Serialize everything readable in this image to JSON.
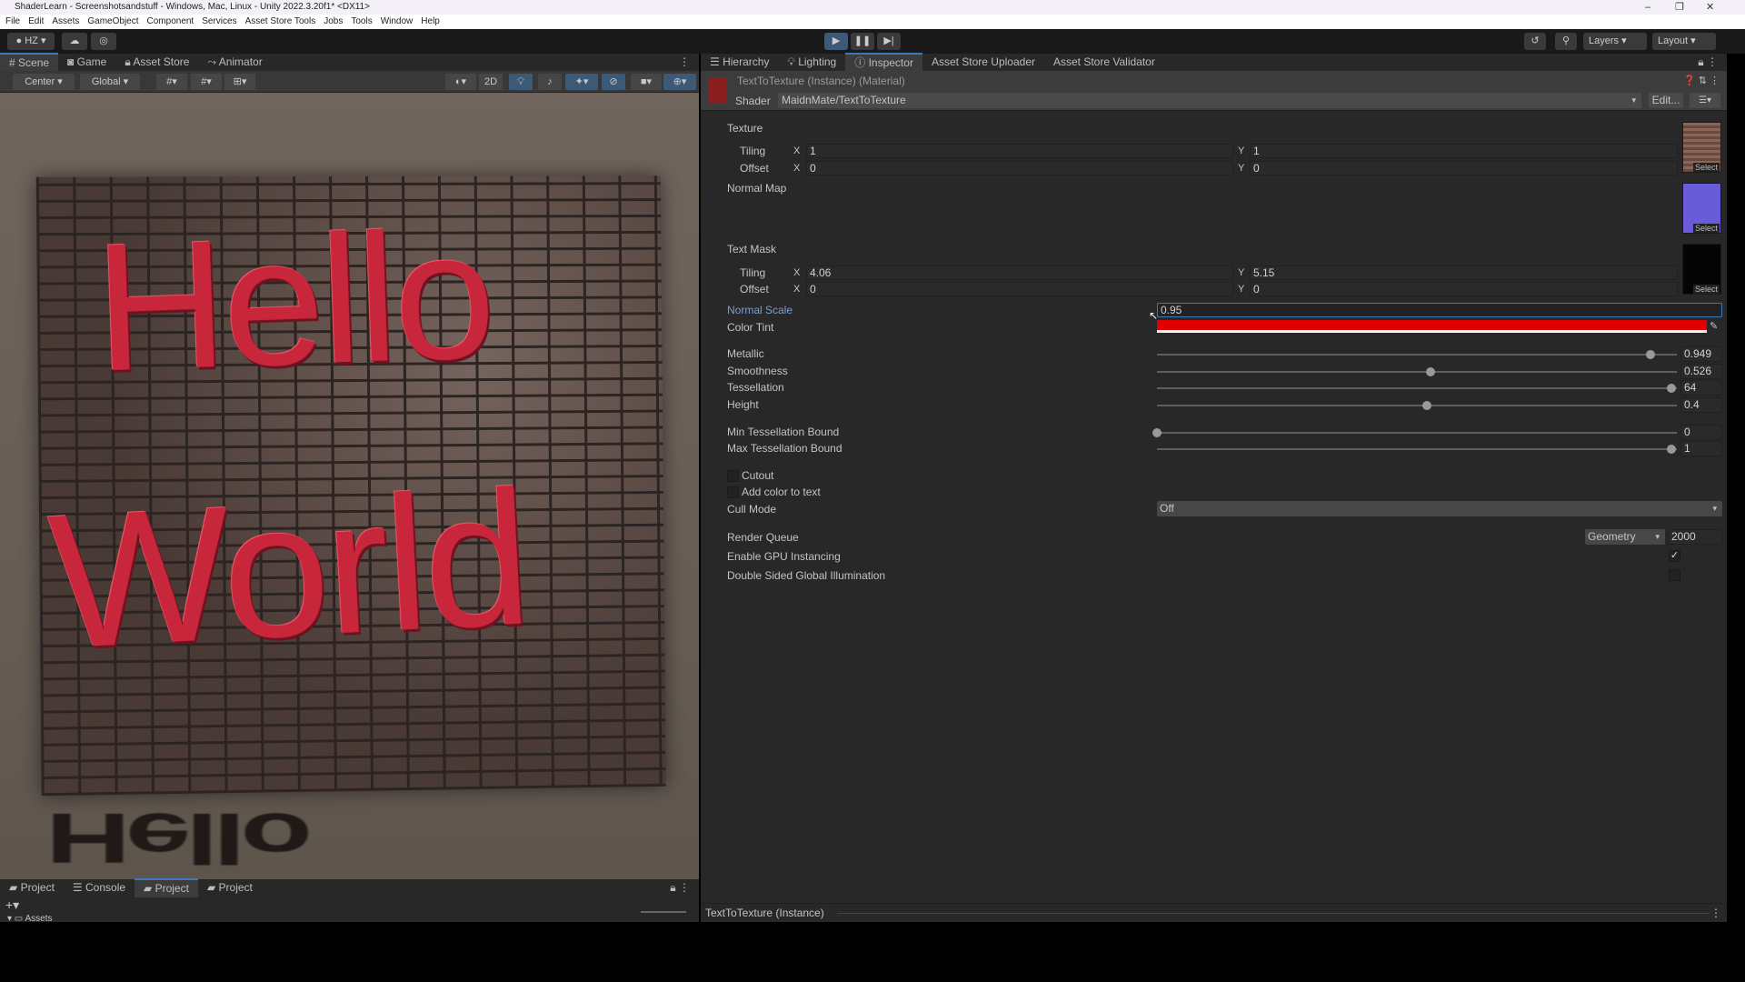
{
  "window": {
    "title": "ShaderLearn - Screenshotsandstuff - Windows, Mac, Linux - Unity 2022.3.20f1* <DX11>",
    "controls": [
      "–",
      "❐",
      "✕"
    ]
  },
  "menu": [
    "File",
    "Edit",
    "Assets",
    "GameObject",
    "Component",
    "Services",
    "Asset Store Tools",
    "Jobs",
    "Tools",
    "Window",
    "Help"
  ],
  "toolbar": {
    "account": "HZ ▾",
    "layers": "Layers",
    "layout": "Layout"
  },
  "left_tabs": [
    "Scene",
    "Game",
    "Asset Store",
    "Animator"
  ],
  "scene_toolbar": {
    "pivot": "Center",
    "space": "Global",
    "mode2d": "2D"
  },
  "scene": {
    "text_line1": "Hello",
    "text_line2": "World",
    "reflection": "Hello"
  },
  "bottom_tabs": [
    "Project",
    "Console",
    "Project",
    "Project"
  ],
  "bottom_tree": "Assets",
  "right_tabs": [
    "Hierarchy",
    "Lighting",
    "Inspector",
    "Asset Store Uploader",
    "Asset Store Validator"
  ],
  "inspector": {
    "title": "TextToTexture (Instance) (Material)",
    "shader_label": "Shader",
    "shader": "MaidnMate/TextToTexture",
    "edit": "Edit...",
    "texture": {
      "label": "Texture",
      "tiling_label": "Tiling",
      "offset_label": "Offset",
      "tiling_x": "1",
      "tiling_y": "1",
      "offset_x": "0",
      "offset_y": "0"
    },
    "normal_map": "Normal Map",
    "text_mask": {
      "label": "Text Mask",
      "tiling_label": "Tiling",
      "offset_label": "Offset",
      "tiling_x": "4.06",
      "tiling_y": "5.15",
      "offset_x": "0",
      "offset_y": "0"
    },
    "axis_x": "X",
    "axis_y": "Y",
    "select": "Select",
    "normal_scale": {
      "label": "Normal Scale",
      "value": "0.95"
    },
    "color_tint": {
      "label": "Color Tint",
      "color": "#e00000"
    },
    "sliders": [
      {
        "label": "Metallic",
        "value": "0.949",
        "fraction": 0.949
      },
      {
        "label": "Smoothness",
        "value": "0.526",
        "fraction": 0.526
      },
      {
        "label": "Tessellation",
        "value": "64",
        "fraction": 0.99
      },
      {
        "label": "Height",
        "value": "0.4",
        "fraction": 0.52
      },
      {
        "label": "Min Tessellation Bound",
        "value": "0",
        "fraction": 0.0
      },
      {
        "label": "Max Tessellation Bound",
        "value": "1",
        "fraction": 0.99
      }
    ],
    "cutout": {
      "label": "Cutout",
      "checked": false
    },
    "add_color": {
      "label": "Add color to text",
      "checked": false
    },
    "cull_mode": {
      "label": "Cull Mode",
      "value": "Off"
    },
    "render_queue": {
      "label": "Render Queue",
      "preset": "Geometry",
      "value": "2000"
    },
    "gpu_instancing": {
      "label": "Enable GPU Instancing",
      "checked": true,
      "mark": "✓"
    },
    "double_sided_gi": {
      "label": "Double Sided Global Illumination",
      "checked": false
    },
    "footer": "TextToTexture (Instance)"
  },
  "colors": {
    "accent": "#3a79bb",
    "panel": "#282828",
    "tint": "#e00000",
    "normal_map_thumb": "#6a5cd8"
  }
}
